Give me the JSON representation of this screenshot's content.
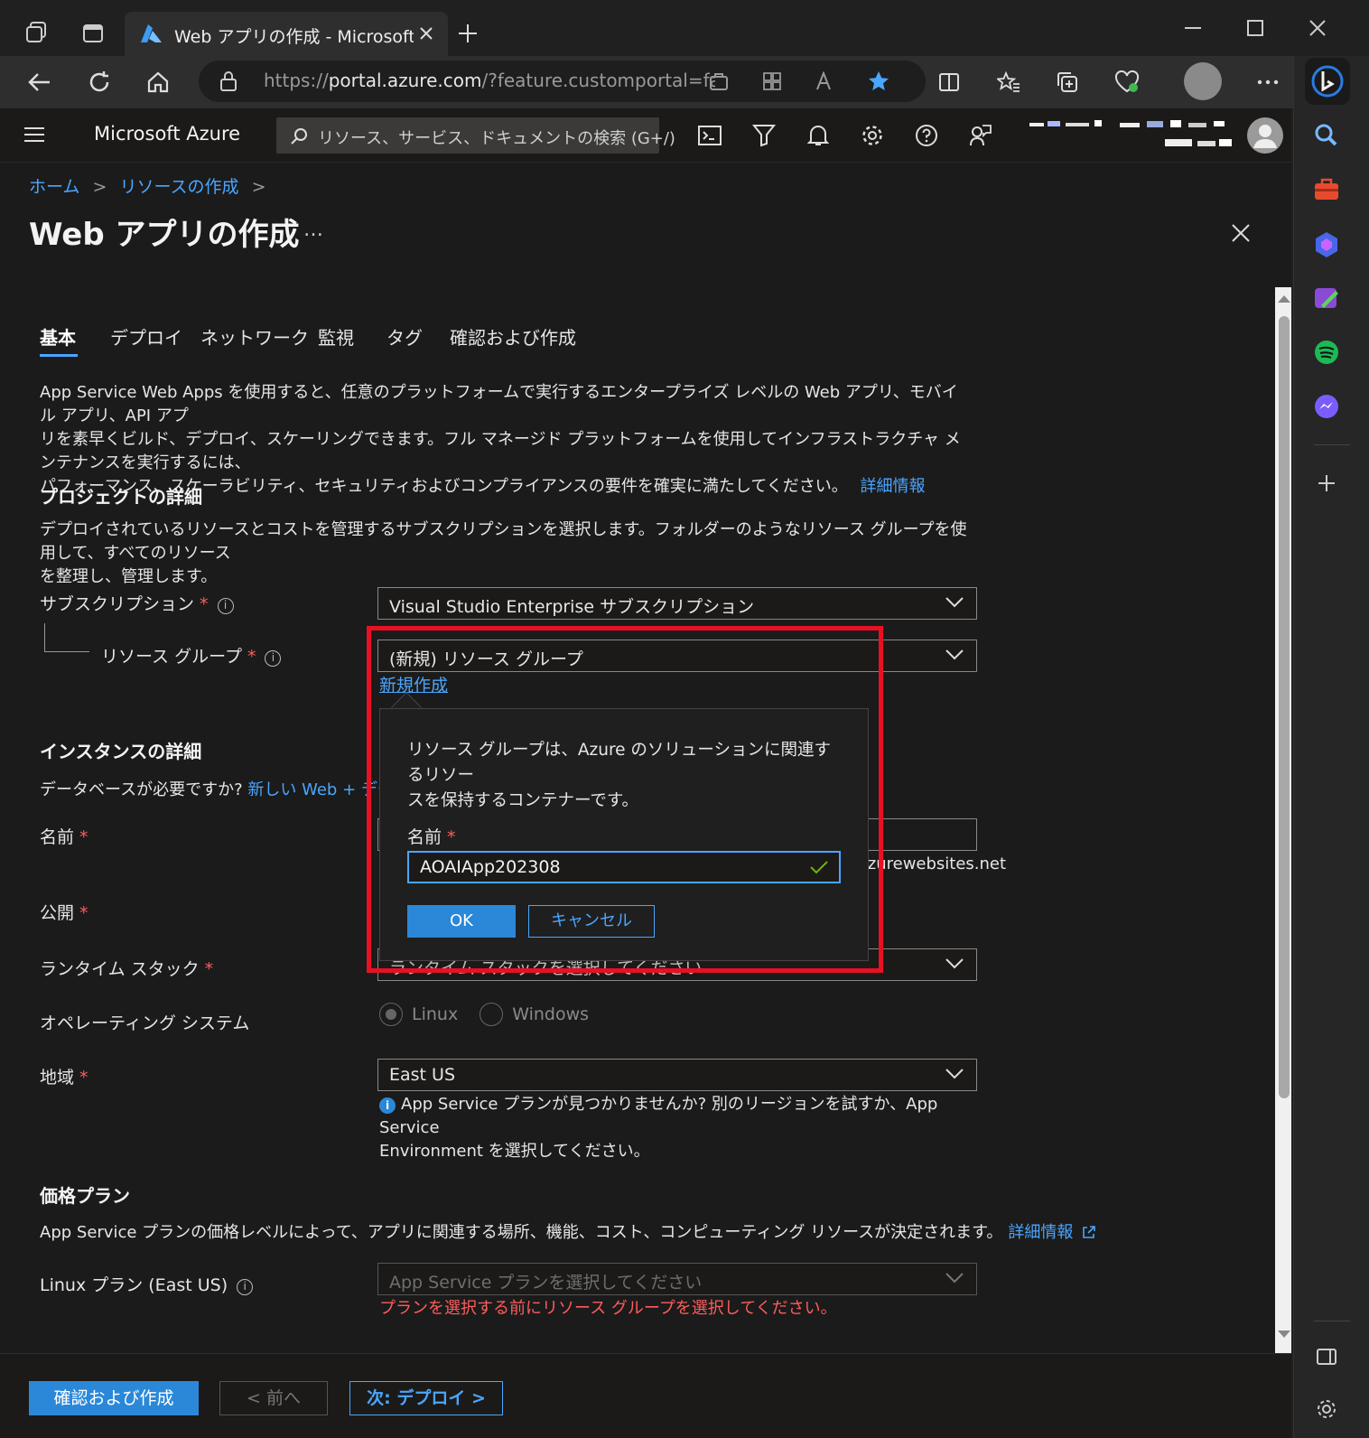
{
  "browser": {
    "tab_title": "Web アプリの作成 - Microsoft Azu",
    "url_prefix": "https://",
    "url_host": "portal.azure.com",
    "url_rest": "/?feature.customportal=fal..."
  },
  "header": {
    "brand": "Microsoft Azure",
    "search_placeholder": "リソース、サービス、ドキュメントの検索 (G+/)"
  },
  "breadcrumb": {
    "home": "ホーム",
    "sep": ">",
    "create": "リソースの作成"
  },
  "page": {
    "title": "Web アプリの作成",
    "more": "…"
  },
  "tabs": [
    {
      "label": "基本"
    },
    {
      "label": "デプロイ"
    },
    {
      "label": "ネットワーク"
    },
    {
      "label": "監視"
    },
    {
      "label": "タグ"
    },
    {
      "label": "確認および作成"
    }
  ],
  "intro": {
    "line1": "App Service Web Apps を使用すると、任意のプラットフォームで実行するエンタープライズ レベルの Web アプリ、モバイル アプリ、API アプ",
    "line2": "リを素早くビルド、デプロイ、スケーリングできます。フル マネージド プラットフォームを使用してインフラストラクチャ メンテナンスを実行するには、",
    "line3": "パフォーマンス、スケーラビリティ、セキュリティおよびコンプライアンスの要件を確実に満たしてください。",
    "link": "詳細情報"
  },
  "project": {
    "heading": "プロジェクトの詳細",
    "desc1": "デプロイされているリソースとコストを管理するサブスクリプションを選択します。フォルダーのようなリソース グループを使用して、すべてのリソース",
    "desc2": "を整理し、管理します。",
    "subscription_label": "サブスクリプション",
    "subscription_value": "Visual Studio Enterprise サブスクリプション",
    "rg_label": "リソース グループ",
    "rg_value": "(新規) リソース グループ",
    "create_new": "新規作成"
  },
  "instance": {
    "heading": "インスタンスの詳細",
    "db_question": "データベースが必要ですか?",
    "db_link": "新しい Web + データベ",
    "name_label": "名前",
    "domain_suffix": ".azurewebsites.net",
    "publish_label": "公開",
    "runtime_label": "ランタイム スタック",
    "runtime_placeholder": "ランタイム スタックを選択してください",
    "os_label": "オペレーティング システム",
    "os_linux": "Linux",
    "os_windows": "Windows",
    "region_label": "地域",
    "region_value": "East US",
    "region_note1": "App Service プランが見つかりませんか? 別のリージョンを試すか、App Service",
    "region_note2": "Environment を選択してください。"
  },
  "callout": {
    "desc1": "リソース グループは、Azure のソリューションに関連するリソー",
    "desc2": "スを保持するコンテナーです。",
    "name_label": "名前",
    "name_value": "AOAIApp202308",
    "ok": "OK",
    "cancel": "キャンセル"
  },
  "pricing": {
    "heading": "価格プラン",
    "desc": "App Service プランの価格レベルによって、アプリに関連する場所、機能、コスト、コンピューティング リソースが決定されます。",
    "link": "詳細情報",
    "plan_label": "Linux プラン (East US)",
    "plan_placeholder": "App Service プランを選択してください",
    "plan_error": "プランを選択する前にリソース グループを選択してください。"
  },
  "footer": {
    "review": "確認および作成",
    "prev": "< 前へ",
    "next": "次: デプロイ >"
  },
  "colors": {
    "accent": "#4aa6ff",
    "error": "#ff5c5c",
    "highlight": "#e81123",
    "primary_button": "#2b88d8"
  }
}
